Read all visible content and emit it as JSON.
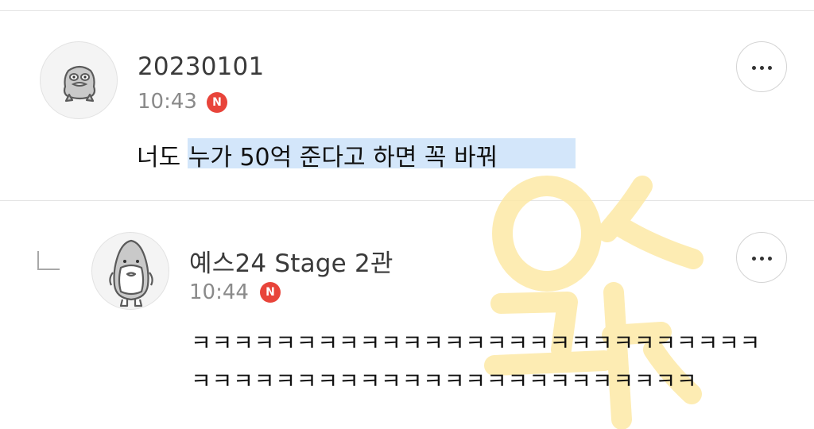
{
  "comments": [
    {
      "username": "20230101",
      "time": "10:43",
      "new_badge": "N",
      "text": "너도 누가 50억 준다고 하면 꼭 바꿔",
      "avatar": "duck-character-icon",
      "more_icon": "more-horizontal-icon"
    },
    {
      "username": "예스24 Stage 2관",
      "time": "10:44",
      "new_badge": "N",
      "text_line1": "ㅋㅋㅋㅋㅋㅋㅋㅋㅋㅋㅋㅋㅋㅋㅋㅋㅋㅋㅋㅋㅋㅋㅋㅋㅋㅋㅋ",
      "text_line2": "ㅋㅋㅋㅋㅋㅋㅋㅋㅋㅋㅋㅋㅋㅋㅋㅋㅋㅋㅋㅋㅋㅋㅋㅋ",
      "avatar": "penguin-character-icon",
      "reply_icon": "reply-arrow-icon",
      "more_icon": "more-horizontal-icon"
    }
  ],
  "colors": {
    "highlight": "#d3e6fa",
    "new_badge": "#e8443a",
    "watermark": "#fde9a6"
  }
}
